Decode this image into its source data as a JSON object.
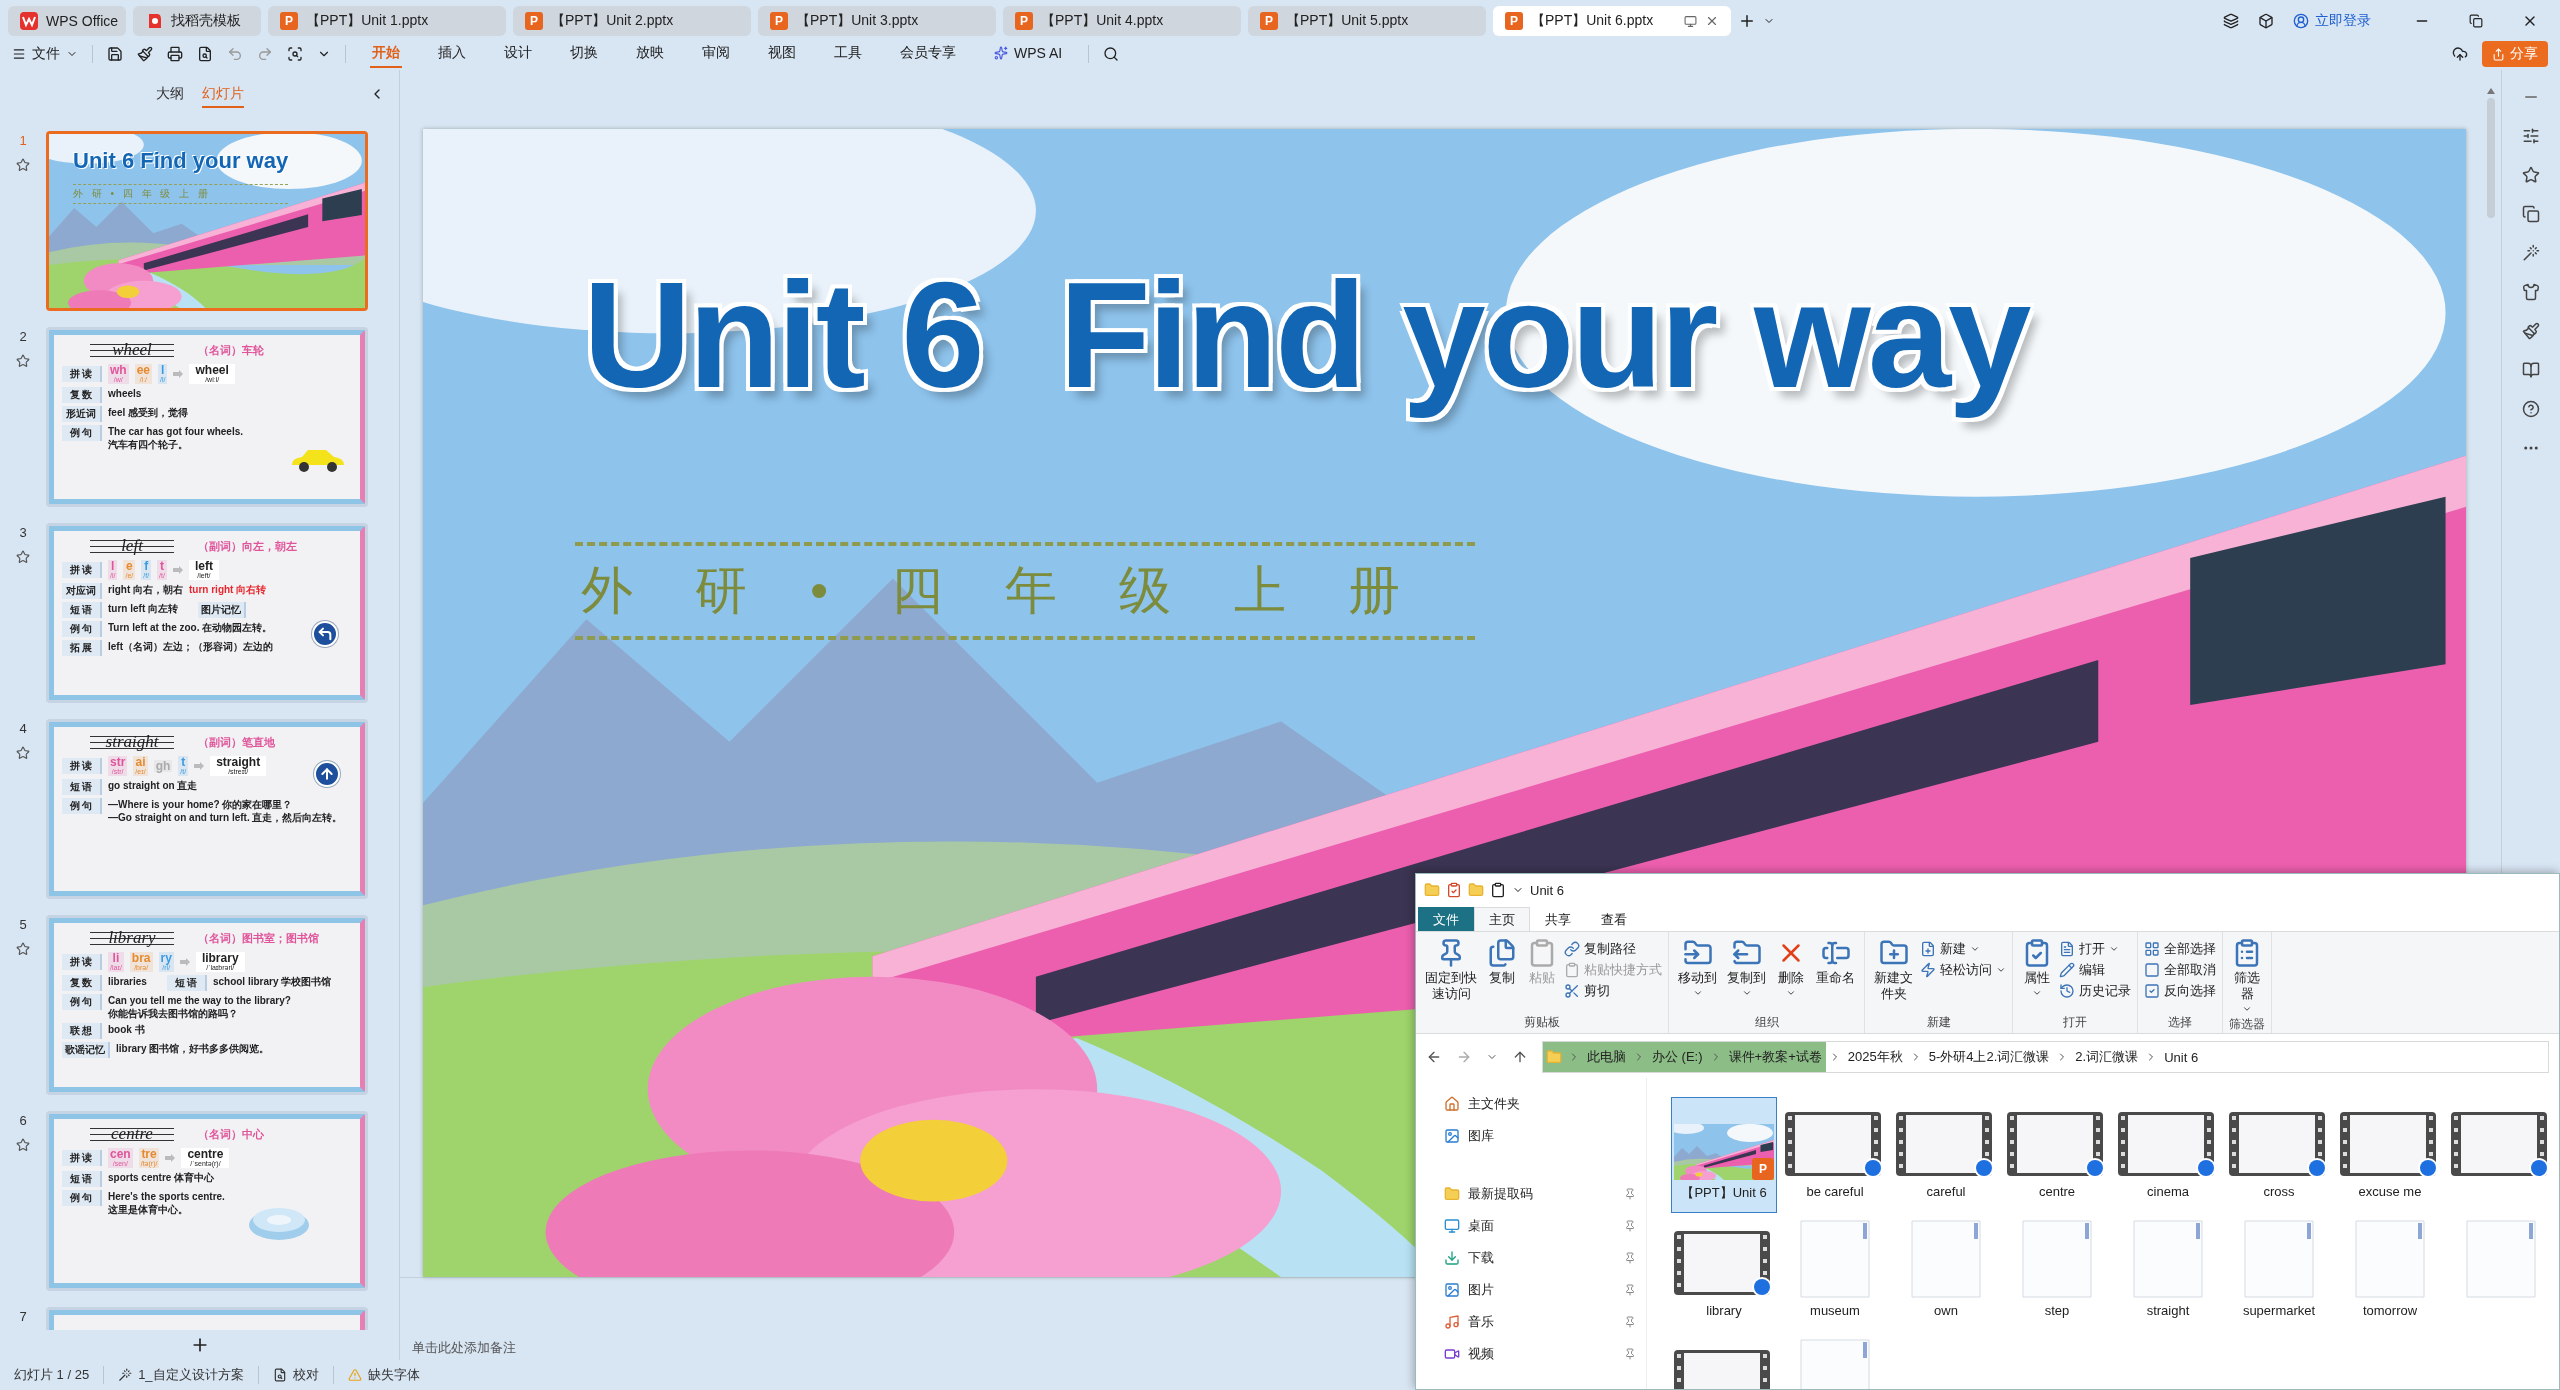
{
  "tabs": [
    {
      "kind": "home",
      "label": "WPS Office",
      "selected": false
    },
    {
      "kind": "template",
      "label": "找稻壳模板",
      "selected": false
    },
    {
      "kind": "doc",
      "badge": "P",
      "label": "【PPT】Unit 1.pptx",
      "selected": false
    },
    {
      "kind": "doc",
      "badge": "P",
      "label": "【PPT】Unit 2.pptx",
      "selected": false
    },
    {
      "kind": "doc",
      "badge": "P",
      "label": "【PPT】Unit 3.pptx",
      "selected": false
    },
    {
      "kind": "doc",
      "badge": "P",
      "label": "【PPT】Unit 4.pptx",
      "selected": false
    },
    {
      "kind": "doc",
      "badge": "P",
      "label": "【PPT】Unit 5.pptx",
      "selected": false
    },
    {
      "kind": "doc",
      "badge": "P",
      "label": "【PPT】Unit 6.pptx",
      "selected": true
    }
  ],
  "account": {
    "label": "立即登录"
  },
  "menu": {
    "file": "文件",
    "tabs": [
      {
        "kind": "text",
        "label": "开始",
        "selected": true
      },
      {
        "kind": "text",
        "label": "插入",
        "selected": false
      },
      {
        "kind": "text",
        "label": "设计",
        "selected": false
      },
      {
        "kind": "text",
        "label": "切换",
        "selected": false
      },
      {
        "kind": "text",
        "label": "放映",
        "selected": false
      },
      {
        "kind": "text",
        "label": "审阅",
        "selected": false
      },
      {
        "kind": "text",
        "label": "视图",
        "selected": false
      },
      {
        "kind": "text",
        "label": "工具",
        "selected": false
      },
      {
        "kind": "text",
        "label": "会员专享",
        "selected": false
      },
      {
        "kind": "ai",
        "label": "WPS AI",
        "selected": false
      }
    ],
    "share": "分享"
  },
  "sidebar": {
    "tabs": [
      {
        "label": "大纲",
        "selected": false
      },
      {
        "label": "幻灯片",
        "selected": true
      }
    ],
    "slides": [
      {
        "number": "1",
        "selected": true,
        "kind": "cover",
        "title": "Unit 6  Find your way",
        "subtitle": "外 研 • 四 年 级 上 册"
      },
      {
        "number": "2",
        "selected": false,
        "kind": "word",
        "word": "wheel",
        "meaning": "（名词）车轮",
        "phonics_label": "拼 读",
        "parts": [
          {
            "text": "wh",
            "ipa": "/w/",
            "color": "#e0559a"
          },
          {
            "text": "ee",
            "ipa": "/iː/",
            "color": "#e58a2e"
          },
          {
            "text": "l",
            "ipa": "/l/",
            "color": "#3a9be0"
          }
        ],
        "result": "wheel",
        "result_ipa": "/wiːl/",
        "rows": [
          {
            "label": "复 数",
            "lines": [
              "wheels"
            ]
          },
          {
            "label": "形近词",
            "lines": [
              "feel 感受到，觉得"
            ]
          },
          {
            "label": "例 句",
            "lines": [
              "The car has got four **wheels**.",
              "汽车有四个轮子。"
            ]
          }
        ],
        "illustration": {
          "kind": "car"
        }
      },
      {
        "number": "3",
        "selected": false,
        "kind": "word",
        "word": "left",
        "meaning": "（副词）向左，朝左",
        "phonics_label": "拼 读",
        "parts": [
          {
            "text": "l",
            "ipa": "/l/",
            "color": "#e0559a"
          },
          {
            "text": "e",
            "ipa": "/e/",
            "color": "#e58a2e"
          },
          {
            "text": "f",
            "ipa": "/f/",
            "color": "#3a9be0"
          },
          {
            "text": "t",
            "ipa": "/t/",
            "color": "#e0559a"
          }
        ],
        "result": "left",
        "result_ipa": "/left/",
        "rows": [
          {
            "label": "对应词",
            "lines": [
              "right 向右，朝右"
            ],
            "note": "turn right 向右转"
          },
          {
            "label": "短 语",
            "lines": [
              "turn left 向左转"
            ],
            "extra": {
              "label": "图片记忆"
            }
          },
          {
            "label": "例 句",
            "lines": [
              "Turn **left** at the zoo. 在动物园左转。"
            ]
          },
          {
            "label": "拓 展",
            "lines": [
              "left（名词）左边；（形容词）左边的"
            ]
          }
        ],
        "illustration": {
          "kind": "turn-left"
        }
      },
      {
        "number": "4",
        "selected": false,
        "kind": "word",
        "word": "straight",
        "meaning": "（副词）笔直地",
        "phonics_label": "拼 读",
        "parts": [
          {
            "text": "str",
            "ipa": "/str/",
            "color": "#e0559a"
          },
          {
            "text": "ai",
            "ipa": "/eɪ/",
            "color": "#e58a2e"
          },
          {
            "text": "gh",
            "color": "#aaaaaa"
          },
          {
            "text": "t",
            "ipa": "/t/",
            "color": "#3a9be0"
          }
        ],
        "result": "straight",
        "result_ipa": "/streɪt/",
        "rows": [
          {
            "label": "短 语",
            "lines": [
              "go straight on 直走"
            ]
          },
          {
            "label": "例 句",
            "lines": [
              "—Where is your home? 你的家在哪里？",
              "—Go **straight** on and turn left. 直走，然后向左转。"
            ]
          }
        ],
        "illustration": {
          "kind": "go-straight"
        }
      },
      {
        "number": "5",
        "selected": false,
        "kind": "word",
        "word": "library",
        "meaning": "（名词）图书室；图书馆",
        "phonics_label": "拼 读",
        "parts": [
          {
            "text": "li",
            "ipa": "/laɪ/",
            "color": "#e0559a"
          },
          {
            "text": "bra",
            "ipa": "/brə/",
            "color": "#e58a2e"
          },
          {
            "text": "ry",
            "ipa": "/ri/",
            "color": "#3a9be0"
          }
        ],
        "result": "library",
        "result_ipa": "/ˈlaɪbrəri/",
        "rows": [
          {
            "label": "复 数",
            "lines": [
              "libraries"
            ],
            "extra": {
              "label": "短 语",
              "text": "school library 学校图书馆"
            }
          },
          {
            "label": "例 句",
            "lines": [
              "Can you tell me the way to the **library**?",
              "你能告诉我去图书馆的路吗？"
            ]
          },
          {
            "label": "联 想",
            "lines": [
              "book 书"
            ]
          },
          {
            "label": "歌谣记忆",
            "lines": [
              "library 图书馆，好书多多供阅览。"
            ]
          }
        ]
      },
      {
        "number": "6",
        "selected": false,
        "kind": "word",
        "word": "centre",
        "meaning": "（名词）中心",
        "phonics_label": "拼 读",
        "parts": [
          {
            "text": "cen",
            "ipa": "/sen/",
            "color": "#e0559a"
          },
          {
            "text": "tre",
            "ipa": "/tə(r)/",
            "color": "#e58a2e"
          }
        ],
        "result": "centre",
        "result_ipa": "/ˈsentə(r)/",
        "rows": [
          {
            "label": "短 语",
            "lines": [
              "sports centre 体育中心"
            ]
          },
          {
            "label": "例 句",
            "lines": [
              "Here's the sports **centre**.",
              "这里是体育中心。"
            ]
          }
        ],
        "illustration": {
          "kind": "stadium"
        }
      },
      {
        "number": "7",
        "selected": false,
        "kind": "partial"
      }
    ]
  },
  "slide": {
    "title": "Unit 6  Find your way",
    "subtitle": "外 研 • 四 年 级 上 册"
  },
  "notes": {
    "placeholder": "单击此处添加备注"
  },
  "status_bar": {
    "slide_count": "幻灯片 1 / 25",
    "theme": "1_自定义设计方案",
    "proofing": "校对",
    "missing_fonts": "缺失字体"
  },
  "explorer": {
    "title": "Unit 6",
    "tabs": [
      {
        "kind": "file",
        "label": "文件",
        "selected": false
      },
      {
        "kind": "tab",
        "label": "主页",
        "selected": true
      },
      {
        "kind": "tab",
        "label": "共享",
        "selected": false
      },
      {
        "kind": "tab",
        "label": "查看",
        "selected": false
      }
    ],
    "groups": [
      {
        "label": "剪贴板",
        "items": [
          {
            "kind": "large",
            "label": "固定到快速访问",
            "disabled": false,
            "dropdown": false
          },
          {
            "kind": "large",
            "label": "复制",
            "disabled": false,
            "dropdown": false
          },
          {
            "kind": "large",
            "label": "粘贴",
            "disabled": true,
            "dropdown": false
          },
          {
            "kind": "small",
            "label": "复制路径",
            "disabled": false,
            "dropdown": false
          },
          {
            "kind": "small",
            "label": "粘贴快捷方式",
            "disabled": true,
            "dropdown": false
          },
          {
            "kind": "small",
            "label": "剪切",
            "disabled": false,
            "dropdown": false
          }
        ]
      },
      {
        "label": "组织",
        "items": [
          {
            "kind": "large",
            "label": "移动到",
            "disabled": false,
            "dropdown": true
          },
          {
            "kind": "large",
            "label": "复制到",
            "disabled": false,
            "dropdown": true
          },
          {
            "kind": "large",
            "label": "删除",
            "disabled": false,
            "dropdown": true
          },
          {
            "kind": "large",
            "label": "重命名",
            "disabled": false,
            "dropdown": false
          }
        ]
      },
      {
        "label": "新建",
        "items": [
          {
            "kind": "large",
            "label": "新建文件夹",
            "disabled": false,
            "dropdown": false
          },
          {
            "kind": "small",
            "label": "新建",
            "disabled": false,
            "dropdown": true
          },
          {
            "kind": "small",
            "label": "轻松访问",
            "disabled": false,
            "dropdown": true
          }
        ]
      },
      {
        "label": "打开",
        "items": [
          {
            "kind": "large",
            "label": "属性",
            "disabled": false,
            "dropdown": true
          },
          {
            "kind": "small",
            "label": "打开",
            "disabled": false,
            "dropdown": true
          },
          {
            "kind": "small",
            "label": "编辑",
            "disabled": false,
            "dropdown": false
          },
          {
            "kind": "small",
            "label": "历史记录",
            "disabled": false,
            "dropdown": false
          }
        ]
      },
      {
        "label": "选择",
        "items": [
          {
            "kind": "small",
            "label": "全部选择",
            "disabled": false,
            "dropdown": false
          },
          {
            "kind": "small",
            "label": "全部取消",
            "disabled": false,
            "dropdown": false
          },
          {
            "kind": "small",
            "label": "反向选择",
            "disabled": false,
            "dropdown": false
          }
        ]
      },
      {
        "label": "筛选器",
        "items": [
          {
            "kind": "large",
            "label": "筛选器",
            "disabled": false,
            "dropdown": true
          }
        ]
      }
    ],
    "breadcrumbs": [
      {
        "label": "此电脑",
        "highlighted": true
      },
      {
        "label": "办公 (E:)",
        "highlighted": true
      },
      {
        "label": "课件+教案+试卷",
        "highlighted": true
      },
      {
        "label": "2025年秋",
        "highlighted": false
      },
      {
        "label": "5-外研4上2.词汇微课",
        "highlighted": false
      },
      {
        "label": "2.词汇微课",
        "highlighted": false
      },
      {
        "label": "Unit 6",
        "highlighted": false
      }
    ],
    "nav": [
      {
        "kind": "home",
        "label": "主文件夹",
        "pinned": false
      },
      {
        "kind": "gallery",
        "label": "图库",
        "pinned": false
      },
      {
        "kind": "folder",
        "label": "最新提取码",
        "pinned": true
      },
      {
        "kind": "desktop",
        "label": "桌面",
        "pinned": true
      },
      {
        "kind": "download",
        "label": "下载",
        "pinned": true
      },
      {
        "kind": "pictures",
        "label": "图片",
        "pinned": true
      },
      {
        "kind": "music",
        "label": "音乐",
        "pinned": true
      },
      {
        "kind": "videos",
        "label": "视频",
        "pinned": true
      }
    ],
    "files": [
      {
        "kind": "pptx",
        "label": "【PPT】Unit 6",
        "badge": "P",
        "selected": true
      },
      {
        "kind": "video",
        "label": "be careful",
        "selected": false
      },
      {
        "kind": "video",
        "label": "careful",
        "selected": false
      },
      {
        "kind": "video",
        "label": "centre",
        "selected": false
      },
      {
        "kind": "video",
        "label": "cinema",
        "selected": false
      },
      {
        "kind": "video",
        "label": "cross",
        "selected": false
      },
      {
        "kind": "video",
        "label": "excuse me",
        "selected": false
      },
      {
        "kind": "video",
        "selected": false
      },
      {
        "kind": "video",
        "label": "library",
        "selected": false
      },
      {
        "kind": "blank",
        "label": "museum",
        "selected": false
      },
      {
        "kind": "blank",
        "label": "own",
        "selected": false
      },
      {
        "kind": "blank",
        "label": "step",
        "selected": false
      },
      {
        "kind": "blank",
        "label": "straight",
        "selected": false
      },
      {
        "kind": "blank",
        "label": "supermarket",
        "selected": false
      },
      {
        "kind": "blank",
        "label": "tomorrow",
        "selected": false
      },
      {
        "kind": "blank",
        "selected": false
      },
      {
        "kind": "video",
        "selected": false
      },
      {
        "kind": "blank",
        "selected": false
      }
    ]
  }
}
